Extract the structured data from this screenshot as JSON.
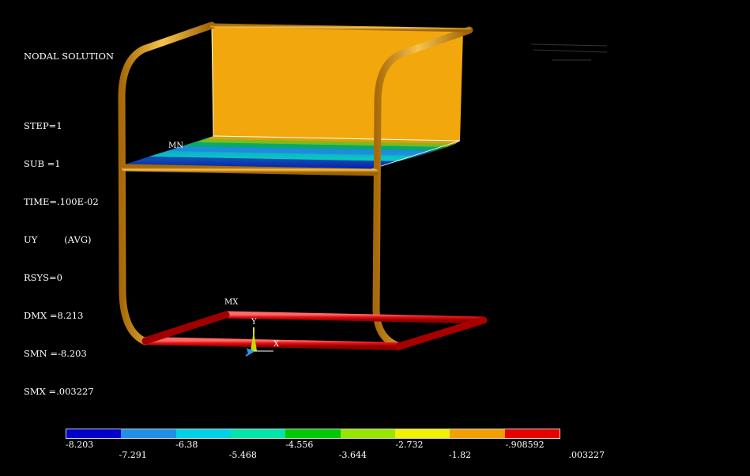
{
  "info": {
    "title": "NODAL SOLUTION",
    "step": "STEP=1",
    "sub": "SUB =1",
    "time": "TIME=.100E-02",
    "uy": "UY",
    "avg": "(AVG)",
    "rsys": "RSYS=0",
    "dmx": "DMX =8.213",
    "smn": "SMN =-8.203",
    "smx": "SMX =.003227"
  },
  "markers": {
    "min": "MN",
    "max": "MX"
  },
  "triad": {
    "y": "Y",
    "x": "X"
  },
  "legend": {
    "colors": [
      "#0000c8",
      "#1e90e6",
      "#00d2e6",
      "#00e6aa",
      "#00c800",
      "#96e600",
      "#f0f000",
      "#f0a000",
      "#e60000"
    ],
    "top_labels": [
      "-8.203",
      "-6.38",
      "-4.556",
      "-2.732",
      "-.908592"
    ],
    "bottom_labels": [
      "-7.291",
      "-5.468",
      "-3.644",
      "-1.82",
      ".003227"
    ]
  },
  "model_colors": {
    "frame": "#e8a020",
    "seat": "#f2a80c",
    "base": "#e01010"
  }
}
